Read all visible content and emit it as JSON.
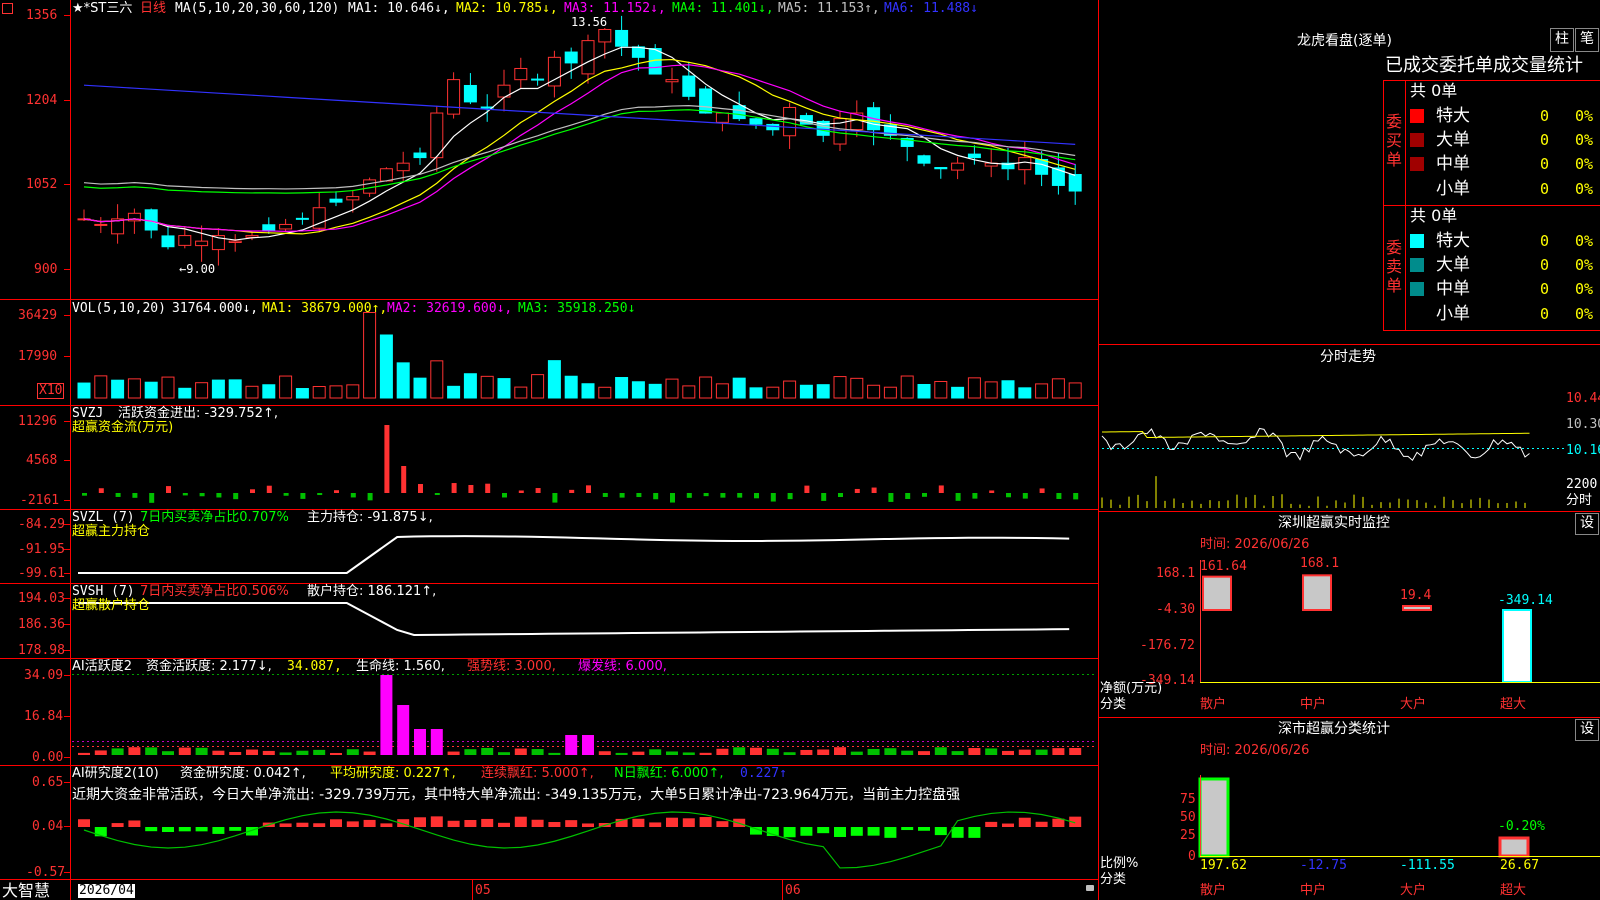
{
  "main_chart": {
    "title_prefix": "★*ST三六",
    "period": "日线",
    "ma_params": "MA(5,10,20,30,60,120)",
    "ma1": "MA1: 10.646↓,",
    "ma2": "MA2: 10.785↓,",
    "ma3": "MA3: 11.152↓,",
    "ma4": "MA4: 11.401↓,",
    "ma5": "MA5: 11.153↑,",
    "ma6": "MA6: 11.488↓",
    "y_ticks": [
      "1356",
      "1204",
      "1052",
      "900"
    ],
    "high_label": "13.56",
    "low_label": "←9.00",
    "x_labels": [
      "2026/04",
      "05",
      "06"
    ]
  },
  "vol_panel": {
    "label": "VOL(5,10,20)",
    "val": "31764.000↓,",
    "ma1": "MA1: 38679.000↑,",
    "ma2": "MA2: 32619.600↓,",
    "ma3": "MA3: 35918.250↓",
    "y_ticks": [
      "36429",
      "17990"
    ],
    "unit": "X10"
  },
  "svzj_panel": {
    "label": "SVZJ",
    "desc": "活跃资金进出: -329.752↑,",
    "sub": "超赢资金流(万元)",
    "y_ticks": [
      "11296",
      "4568",
      "-2161"
    ]
  },
  "svzl_panel": {
    "label": "SVZL (7)",
    "ratio": "7日内买卖净占比0.707%",
    "desc": "主力持仓: -91.875↓,",
    "sub": "超赢主力持仓",
    "y_ticks": [
      "-84.29",
      "-91.95",
      "-99.61"
    ]
  },
  "svsh_panel": {
    "label": "SVSH (7)",
    "ratio": "7日内买卖净占比0.506%",
    "desc": "散户持仓: 186.121↑,",
    "sub": "超赢散户持仓",
    "y_ticks": [
      "194.03",
      "186.36",
      "178.98"
    ]
  },
  "ai_active_panel": {
    "label": "AI活跃度2",
    "desc1": "资金活跃度: 2.177↓,",
    "desc2": "34.087,",
    "desc3": "生命线: 1.560,",
    "desc4": "强势线: 3.000,",
    "desc5": "爆发线: 6.000,",
    "y_ticks": [
      "34.09",
      "16.84",
      "0.00"
    ]
  },
  "ai_research_panel": {
    "label": "AI研究度2(10)",
    "desc1": "资金研究度: 0.042↑,",
    "desc2": "平均研究度: 0.227↑,",
    "desc3": "连续飘红: 5.000↑,",
    "desc4": "N日飘红: 6.000↑,",
    "desc5": "0.227↑",
    "comment": "近期大资金非常活跃，今日大单净流出: -329.739万元，其中特大单净流出: -349.135万元，大单5日累计净出-723.964万元，当前主力控盘强",
    "y_ticks": [
      "0.65",
      "0.04",
      "-0.57"
    ]
  },
  "footer": {
    "brand": "大智慧"
  },
  "right_panel": {
    "title": "龙虎看盘(逐单)",
    "btn_bar": "柱",
    "btn_pen": "笔",
    "table_title": "已成交委托单成交量统计",
    "buy_side": "委买单",
    "sell_side": "委卖单",
    "buy_total": "共 0单",
    "sell_total": "共 0单",
    "rows": [
      "特大",
      "大单",
      "中单",
      "小单"
    ],
    "zero": "0",
    "pct": "0%",
    "colors": {
      "buy_big": "#ff0000",
      "buy_mid": "#a00000",
      "sell_big": "#00ffff",
      "sell_mid": "#008c8c"
    },
    "intraday_title": "分时走势",
    "intraday_y": [
      "10.44",
      "10.30",
      "10.16"
    ],
    "intraday_vol": "2200",
    "intraday_min": "分时",
    "monitor_title": "深圳超赢实时监控",
    "monitor_set": "设",
    "monitor_time": "时间: 2026/06/26",
    "monitor_y": [
      "168.1",
      "-4.30",
      "-176.72",
      "-349.14"
    ],
    "monitor_values": [
      "161.64",
      "168.1",
      "19.4",
      "-349.14"
    ],
    "monitor_unit": "净额(万元)",
    "monitor_cat": "分类",
    "categories": [
      "散户",
      "中户",
      "大户",
      "超大"
    ],
    "stat_title": "深市超赢分类统计",
    "stat_set": "设",
    "stat_time": "时间: 2026/06/26",
    "stat_y": [
      "75",
      "50",
      "25",
      "0"
    ],
    "stat_pct_label": "-0.20%",
    "stat_unit": "比例%",
    "stat_cat": "分类",
    "stat_values": [
      "197.62",
      "-12.75",
      "-111.55",
      "26.67"
    ]
  }
}
